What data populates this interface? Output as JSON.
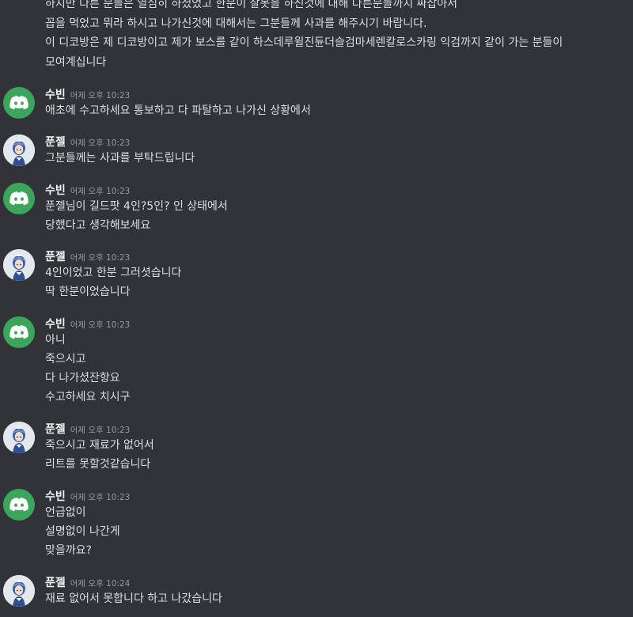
{
  "prev_message": {
    "lines": [
      "하지만 다른 분들은 열심히 하셨었고 한분이 잘못을 하신것에 대해 다른분들까지 싸잡아서",
      "꼽을 먹었고 뭐라 하시고 나가신것에 대해서는 그분들께 사과를 해주시기 바랍니다.",
      "이 디코방은 제 디코방이고 제가 보스를 같이 하스데루윌진듄더슬검마세렌칼로스카링 익검까지 같이 가는 분들이",
      "모여계십니다"
    ]
  },
  "messages": [
    {
      "author": "수빈",
      "time": "어제 오후 10:23",
      "avatar_icon": "discord-logo-icon",
      "lines": [
        "애초에 수고하세요 통보하고 다 파탈하고 나가신 상황에서"
      ]
    },
    {
      "author": "푼젤",
      "time": "어제 오후 10:23",
      "avatar_icon": "anime-character-icon",
      "lines": [
        "그분들께는 사과를 부탁드립니다"
      ]
    },
    {
      "author": "수빈",
      "time": "어제 오후 10:23",
      "avatar_icon": "discord-logo-icon",
      "lines": [
        "푼젤님이 길드팟 4인?5인? 인 상태에서",
        "당했다고 생각해보세요"
      ]
    },
    {
      "author": "푼젤",
      "time": "어제 오후 10:23",
      "avatar_icon": "anime-character-icon",
      "lines": [
        "4인이었고 한분 그러셧습니다",
        "딱 한분이었습니다"
      ]
    },
    {
      "author": "수빈",
      "time": "어제 오후 10:23",
      "avatar_icon": "discord-logo-icon",
      "lines": [
        "아니",
        "죽으시고",
        "다 나가셨잔항요",
        "수고하세요 치시구"
      ]
    },
    {
      "author": "푼젤",
      "time": "어제 오후 10:23",
      "avatar_icon": "anime-character-icon",
      "lines": [
        "죽으시고 재료가 없어서",
        "리트를 못할것같습니다"
      ]
    },
    {
      "author": "수빈",
      "time": "어제 오후 10:23",
      "avatar_icon": "discord-logo-icon",
      "lines": [
        "언급없이",
        "설명없이 나간게",
        "맞을까요?"
      ]
    },
    {
      "author": "푼젤",
      "time": "어제 오후 10:24",
      "avatar_icon": "anime-character-icon",
      "lines": [
        "재료 없어서 못합니다 하고 나갔습니다"
      ]
    }
  ],
  "colors": {
    "background": "#313338",
    "text": "#dbdee1",
    "username": "#f2f3f5",
    "timestamp": "#949ba4",
    "discord_avatar": "#3ba55c"
  }
}
